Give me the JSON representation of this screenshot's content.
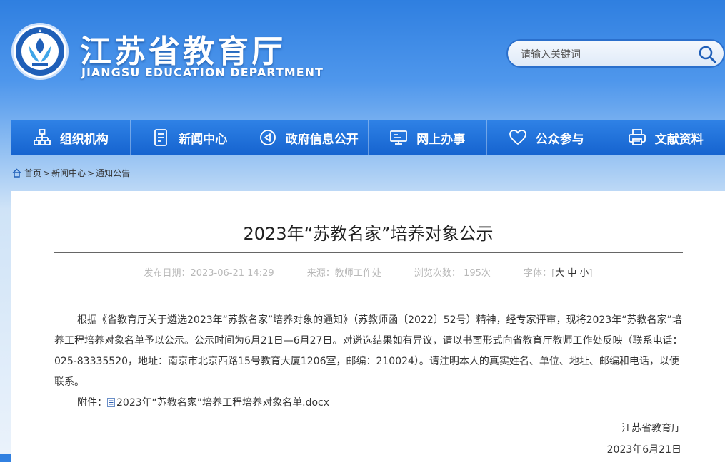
{
  "header": {
    "logo_cn": "江苏省教育厅",
    "logo_en": "JIANGSU EDUCATION DEPARTMENT",
    "emblem_text": "江苏省教育厅"
  },
  "search": {
    "placeholder": "请输入关键词",
    "icon": "search-icon"
  },
  "nav": {
    "items": [
      {
        "label": "组织机构",
        "icon": "org-chart-icon"
      },
      {
        "label": "新闻中心",
        "icon": "document-icon"
      },
      {
        "label": "政府信息公开",
        "icon": "speaker-icon"
      },
      {
        "label": "网上办事",
        "icon": "monitor-icon"
      },
      {
        "label": "公众参与",
        "icon": "heart-icon"
      },
      {
        "label": "文献资料",
        "icon": "printer-icon"
      }
    ]
  },
  "breadcrumb": {
    "home": "首页",
    "news": "新闻中心",
    "current": "通知公告",
    "sep": ">"
  },
  "article": {
    "title": "2023年“苏教名家”培养对象公示",
    "meta": {
      "published": "发布日期：2023-06-21 14:29",
      "source": "来源：教师工作处",
      "views": "浏览次数： 195次",
      "font_label": "字体：",
      "font_large": "大",
      "font_medium": "中",
      "font_small": "小"
    },
    "paragraph": "根据《省教育厅关于遴选2023年“苏教名家”培养对象的通知》（苏教师函〔2022〕52号）精神，经专家评审，现将2023年“苏教名家”培养工程培养对象名单予以公示。公示时间为6月21日—6月27日。对遴选结果如有异议，请以书面形式向省教育厅教师工作处反映（联系电话：025-83335520，地址：南京市北京西路15号教育大厦1206室，邮编：210024）。请注明本人的真实姓名、单位、地址、邮编和电话，以便联系。",
    "attachment_label": "附件：",
    "attachment_file": "2023年“苏教名家”培养工程培养对象名单.docx",
    "signature": "江苏省教育厅",
    "date": "2023年6月21日"
  },
  "colors": {
    "nav_bg": "#1a6bd6",
    "accent": "#2a6fcc"
  }
}
